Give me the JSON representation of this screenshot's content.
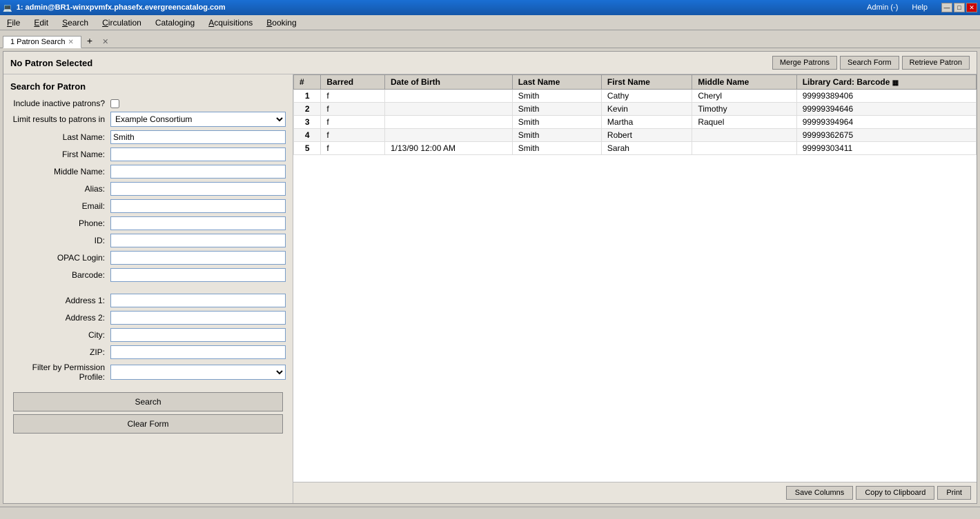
{
  "titleBar": {
    "title": "1: admin@BR1-winxpvmfx.phasefx.evergreencatalog.com",
    "controls": [
      "minimize",
      "maximize",
      "close"
    ],
    "adminLabel": "Admin (-)",
    "helpLabel": "Help"
  },
  "menuBar": {
    "items": [
      "File",
      "Edit",
      "Search",
      "Circulation",
      "Cataloging",
      "Acquisitions",
      "Booking"
    ]
  },
  "tabs": [
    {
      "label": "1 Patron Search",
      "active": true
    },
    {
      "label": "+",
      "isAdd": true
    }
  ],
  "actionBar": {
    "noPatronText": "No Patron Selected",
    "buttons": [
      "Merge Patrons",
      "Search Form",
      "Retrieve Patron"
    ]
  },
  "searchForm": {
    "title": "Search for Patron",
    "fields": [
      {
        "label": "Include inactive patrons?",
        "type": "checkbox",
        "name": "include-inactive"
      },
      {
        "label": "Limit results to patrons in",
        "type": "select",
        "value": "Example Consortium",
        "name": "limit-results"
      },
      {
        "label": "Last Name:",
        "type": "text",
        "value": "Smith",
        "name": "last-name"
      },
      {
        "label": "First Name:",
        "type": "text",
        "value": "",
        "name": "first-name"
      },
      {
        "label": "Middle Name:",
        "type": "text",
        "value": "",
        "name": "middle-name"
      },
      {
        "label": "Alias:",
        "type": "text",
        "value": "",
        "name": "alias"
      },
      {
        "label": "Email:",
        "type": "text",
        "value": "",
        "name": "email"
      },
      {
        "label": "Phone:",
        "type": "text",
        "value": "",
        "name": "phone"
      },
      {
        "label": "ID:",
        "type": "text",
        "value": "",
        "name": "id"
      },
      {
        "label": "OPAC Login:",
        "type": "text",
        "value": "",
        "name": "opac-login"
      },
      {
        "label": "Barcode:",
        "type": "text",
        "value": "",
        "name": "barcode"
      },
      {
        "label": "Address 1:",
        "type": "text",
        "value": "",
        "name": "address1"
      },
      {
        "label": "Address 2:",
        "type": "text",
        "value": "",
        "name": "address2"
      },
      {
        "label": "City:",
        "type": "text",
        "value": "",
        "name": "city"
      },
      {
        "label": "ZIP:",
        "type": "text",
        "value": "",
        "name": "zip"
      },
      {
        "label": "Filter by Permission Profile:",
        "type": "select",
        "value": "",
        "name": "permission-profile"
      }
    ],
    "searchButton": "Search",
    "clearButton": "Clear Form"
  },
  "resultsTable": {
    "columns": [
      "#",
      "Barred",
      "Date of Birth",
      "Last Name",
      "First Name",
      "Middle Name",
      "Library Card: Barcode"
    ],
    "rows": [
      {
        "num": "1",
        "barred": "f",
        "dob": "",
        "lastName": "Smith",
        "firstName": "Cathy",
        "middleName": "Cheryl",
        "barcode": "99999389406"
      },
      {
        "num": "2",
        "barred": "f",
        "dob": "",
        "lastName": "Smith",
        "firstName": "Kevin",
        "middleName": "Timothy",
        "barcode": "99999394646"
      },
      {
        "num": "3",
        "barred": "f",
        "dob": "",
        "lastName": "Smith",
        "firstName": "Martha",
        "middleName": "Raquel",
        "barcode": "99999394964"
      },
      {
        "num": "4",
        "barred": "f",
        "dob": "",
        "lastName": "Smith",
        "firstName": "Robert",
        "middleName": "",
        "barcode": "99999362675"
      },
      {
        "num": "5",
        "barred": "f",
        "dob": "1/13/90 12:00 AM",
        "lastName": "Smith",
        "firstName": "Sarah",
        "middleName": "",
        "barcode": "99999303411"
      }
    ]
  },
  "bottomBar": {
    "buttons": [
      "Save Columns",
      "Copy to Clipboard",
      "Print"
    ]
  }
}
